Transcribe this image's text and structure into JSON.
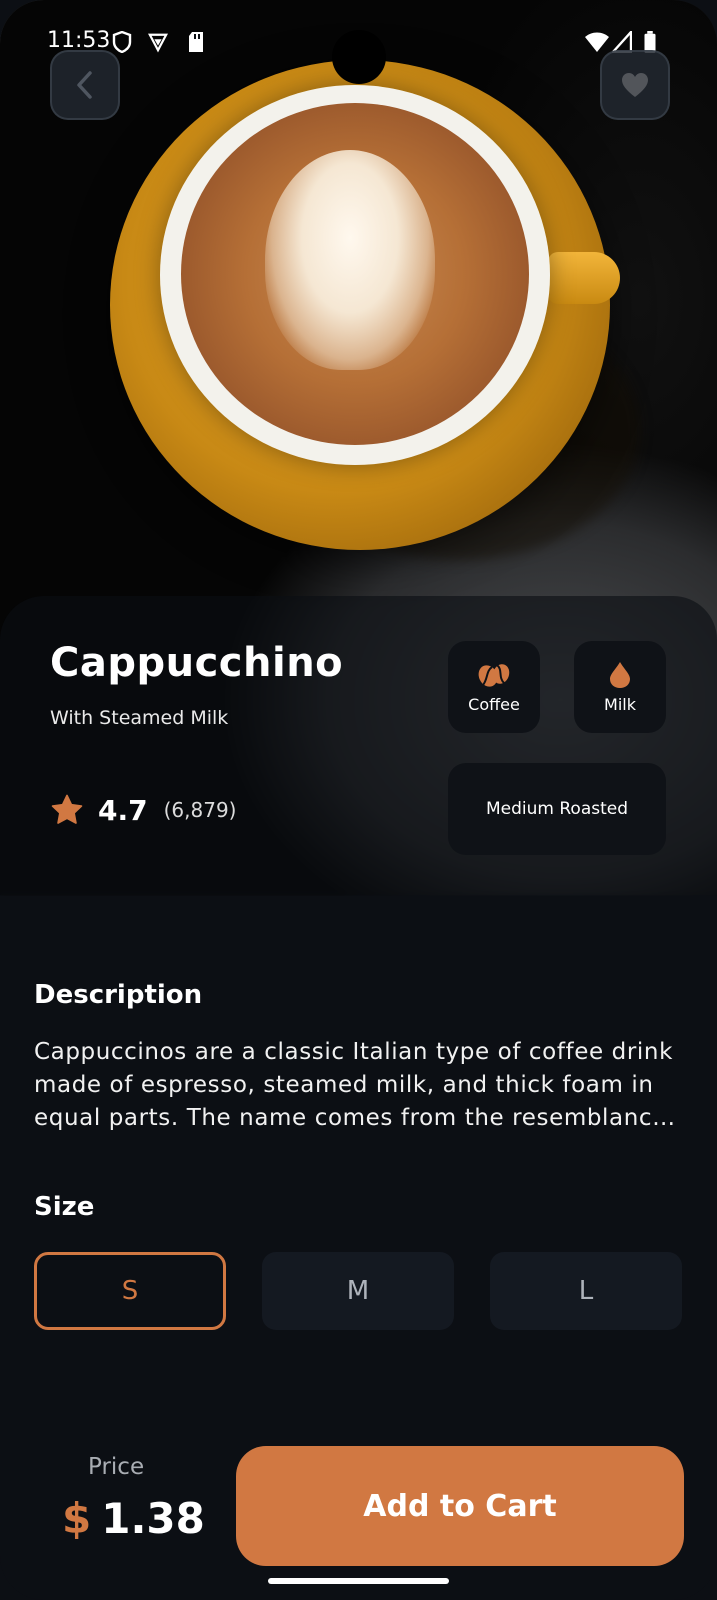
{
  "status_bar": {
    "time": "11:53"
  },
  "product": {
    "name": "Cappucchino",
    "subtitle": "With Steamed Milk",
    "rating": "4.7",
    "rating_count": "(6,879)",
    "tags": [
      {
        "label": "Coffee",
        "icon": "coffee-bean-icon"
      },
      {
        "label": "Milk",
        "icon": "milk-drop-icon"
      }
    ],
    "roast": "Medium Roasted"
  },
  "description": {
    "title": "Description",
    "text": "Cappuccinos are a classic Italian type of coffee drink made of espresso, steamed milk, and thick foam in equal parts. The name comes from the resemblance of its color to the robes of the Capuchin friars."
  },
  "size": {
    "title": "Size",
    "options": [
      "S",
      "M",
      "L"
    ],
    "selected": "S"
  },
  "footer": {
    "price_label": "Price",
    "currency": "$",
    "price": "1.38",
    "cta": "Add to Cart"
  },
  "colors": {
    "accent": "#d17842",
    "background": "#0c0f14",
    "chip": "#141921"
  }
}
